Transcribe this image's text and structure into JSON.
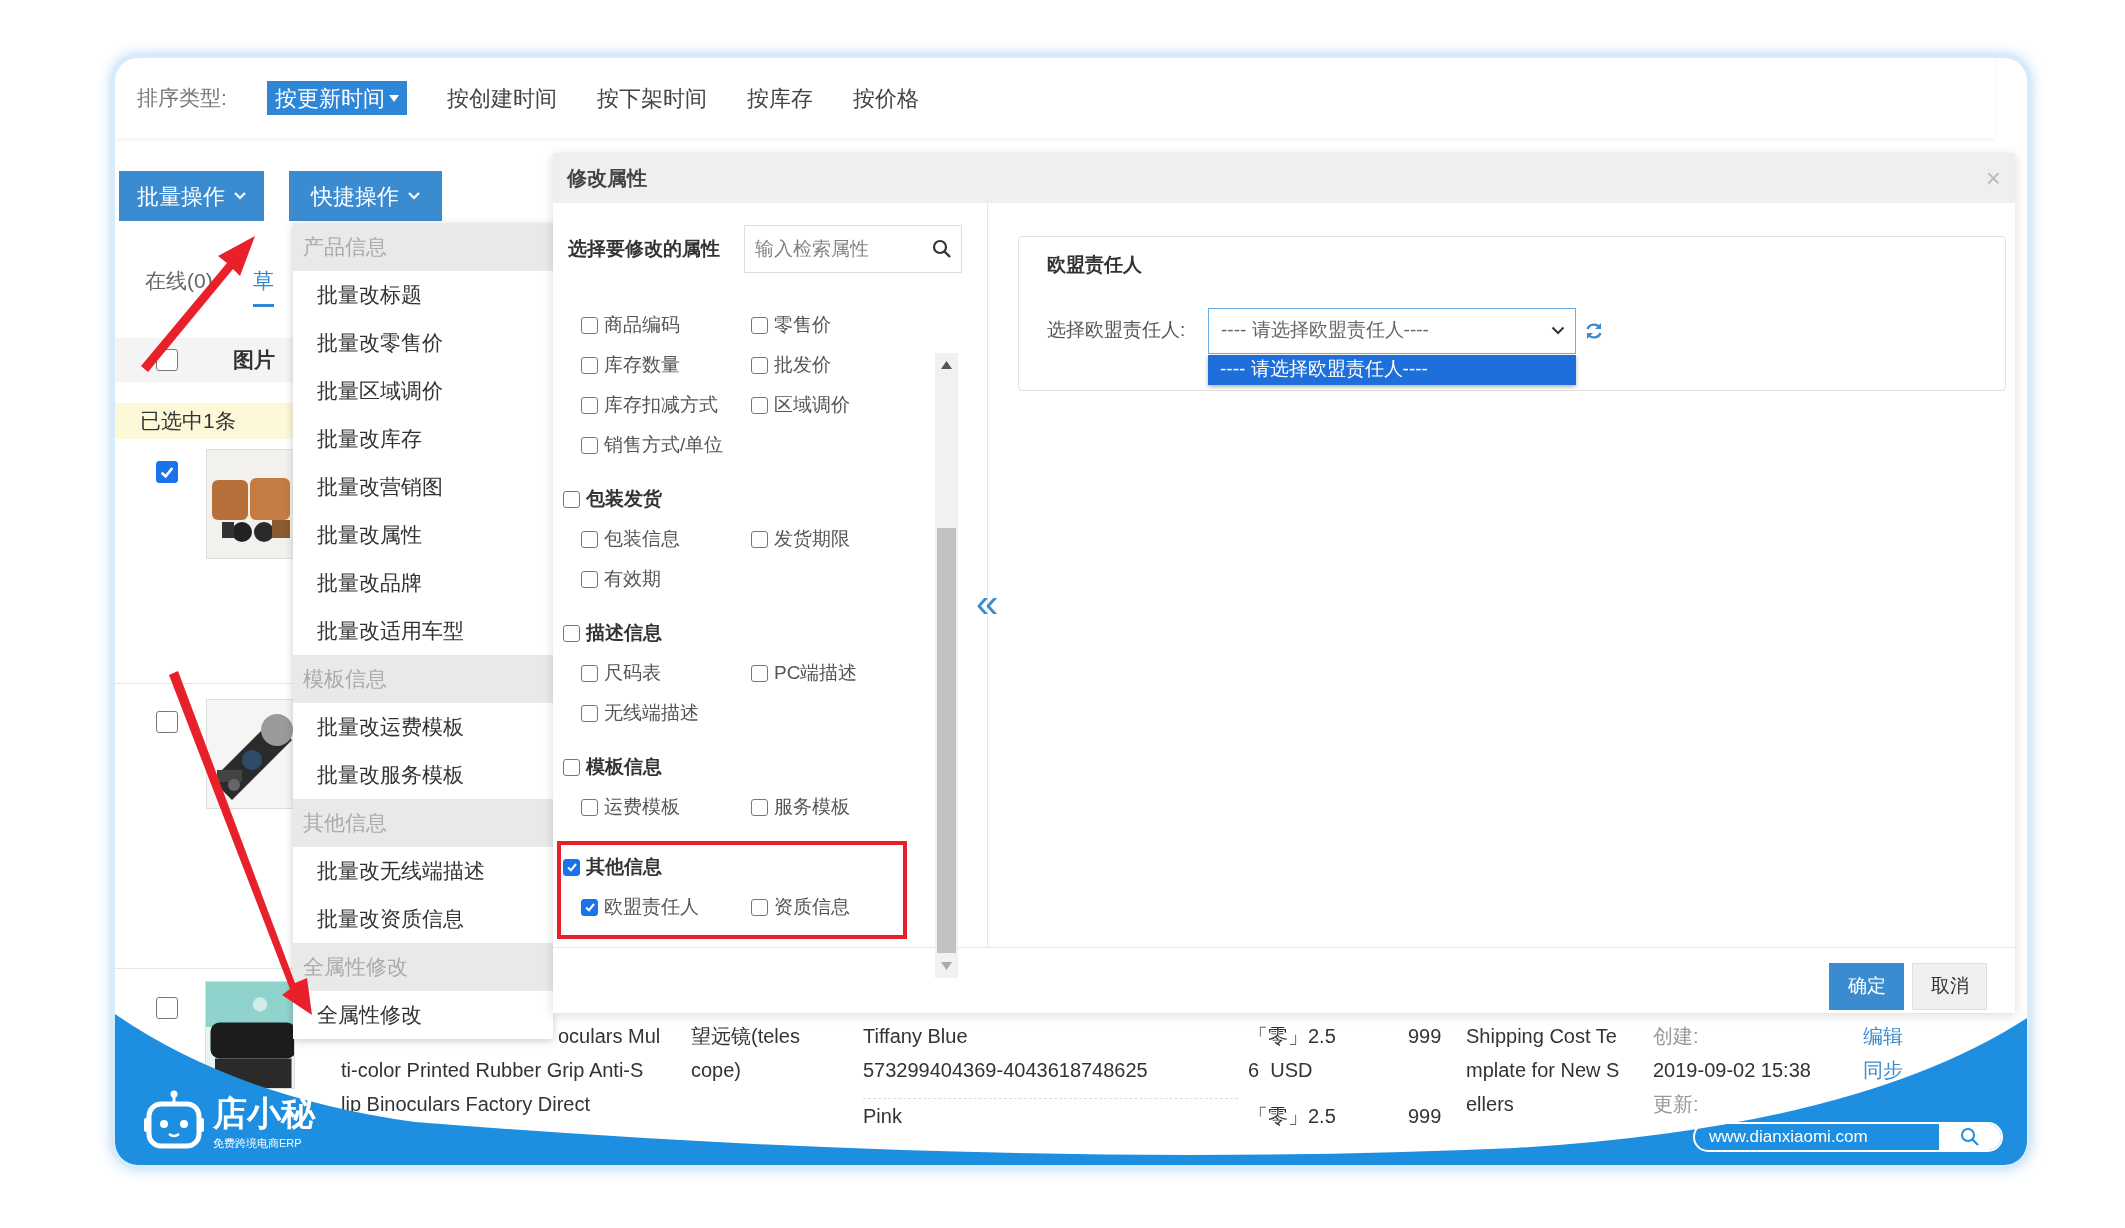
{
  "sort_bar": {
    "label": "排序类型:",
    "options": [
      {
        "label": "按更新时间",
        "selected": true
      },
      {
        "label": "按创建时间",
        "selected": false
      },
      {
        "label": "按下架时间",
        "selected": false
      },
      {
        "label": "按库存",
        "selected": false
      },
      {
        "label": "按价格",
        "selected": false
      }
    ]
  },
  "action_buttons": [
    "批量操作",
    "快捷操作"
  ],
  "tabs": [
    {
      "label": "在线(0)",
      "selected": false
    },
    {
      "label": "草",
      "selected": true
    }
  ],
  "table": {
    "header": {
      "checked": false,
      "column": "图片"
    },
    "selection_notice": "已选中1条",
    "rows": [
      {
        "checked": true,
        "kind": "picture"
      },
      {
        "checked": false,
        "kind": "picture"
      },
      {
        "checked": false,
        "kind": "picture",
        "title_lines": [
          "oculars Mul",
          "ti-color Printed Rubber Grip Anti-S",
          "lip Binoculars Factory Direct"
        ],
        "category_lines": [
          "望远镜(teles",
          "cope)"
        ],
        "variants": [
          {
            "lines": [
              "Tiffany Blue",
              "573299404369-4043618748625"
            ],
            "price_lines": [
              "「零」2.5",
              "6  USD"
            ],
            "stock": "999"
          },
          {
            "lines": [
              "Pink"
            ],
            "price_lines": [
              "「零」2.5"
            ],
            "stock": "999"
          }
        ],
        "template_lines": [
          "Shipping Cost Te",
          "mplate for New S",
          "ellers"
        ],
        "time_lines": [
          "创建:",
          "2019-09-02 15:38",
          "更新:"
        ],
        "links": [
          "编辑",
          "同步"
        ]
      }
    ]
  },
  "quick_menu": [
    {
      "title": "产品信息",
      "items": [
        "批量改标题",
        "批量改零售价",
        "批量区域调价",
        "批量改库存",
        "批量改营销图",
        "批量改属性",
        "批量改品牌",
        "批量改适用车型"
      ]
    },
    {
      "title": "模板信息",
      "items": [
        "批量改运费模板",
        "批量改服务模板"
      ]
    },
    {
      "title": "其他信息",
      "items": [
        "批量改无线端描述",
        "批量改资质信息"
      ]
    },
    {
      "title": "全属性修改",
      "items": [
        "全属性修改"
      ]
    }
  ],
  "modal": {
    "title": "修改属性",
    "close": "×",
    "search": {
      "label": "选择要修改的属性",
      "placeholder": "输入检索属性"
    },
    "groups": [
      {
        "items": [
          {
            "label": "商品编码",
            "checked": false
          },
          {
            "label": "零售价",
            "checked": false
          },
          {
            "label": "库存数量",
            "checked": false
          },
          {
            "label": "批发价",
            "checked": false
          },
          {
            "label": "库存扣减方式",
            "checked": false
          },
          {
            "label": "区域调价",
            "checked": false
          },
          {
            "label": "销售方式/单位",
            "checked": false
          }
        ],
        "highlighted": false
      },
      {
        "title": "包装发货",
        "checked": false,
        "highlighted": false,
        "items": [
          {
            "label": "包装信息",
            "checked": false
          },
          {
            "label": "发货期限",
            "checked": false
          },
          {
            "label": "有效期",
            "checked": false
          }
        ]
      },
      {
        "title": "描述信息",
        "checked": false,
        "highlighted": false,
        "items": [
          {
            "label": "尺码表",
            "checked": false
          },
          {
            "label": "PC端描述",
            "checked": false
          },
          {
            "label": "无线端描述",
            "checked": false
          }
        ]
      },
      {
        "title": "模板信息",
        "checked": false,
        "highlighted": false,
        "items": [
          {
            "label": "运费模板",
            "checked": false
          },
          {
            "label": "服务模板",
            "checked": false
          }
        ]
      },
      {
        "title": "其他信息",
        "checked": true,
        "highlighted": true,
        "items": [
          {
            "label": "欧盟责任人",
            "checked": true
          },
          {
            "label": "资质信息",
            "checked": false
          }
        ]
      }
    ],
    "collapse": "«",
    "panel": {
      "title": "欧盟责任人",
      "field_label": "选择欧盟责任人:",
      "select_value": "---- 请选择欧盟责任人----",
      "options": [
        {
          "label": "---- 请选择欧盟责任人----",
          "selected": true
        }
      ]
    },
    "buttons": [
      {
        "label": "确定",
        "kind": "primary"
      },
      {
        "label": "取消",
        "kind": "default"
      }
    ]
  },
  "banner": {
    "brand": "店小秘",
    "tagline": "免费跨境电商ERP",
    "url": "www.dianxiaomi.com"
  }
}
